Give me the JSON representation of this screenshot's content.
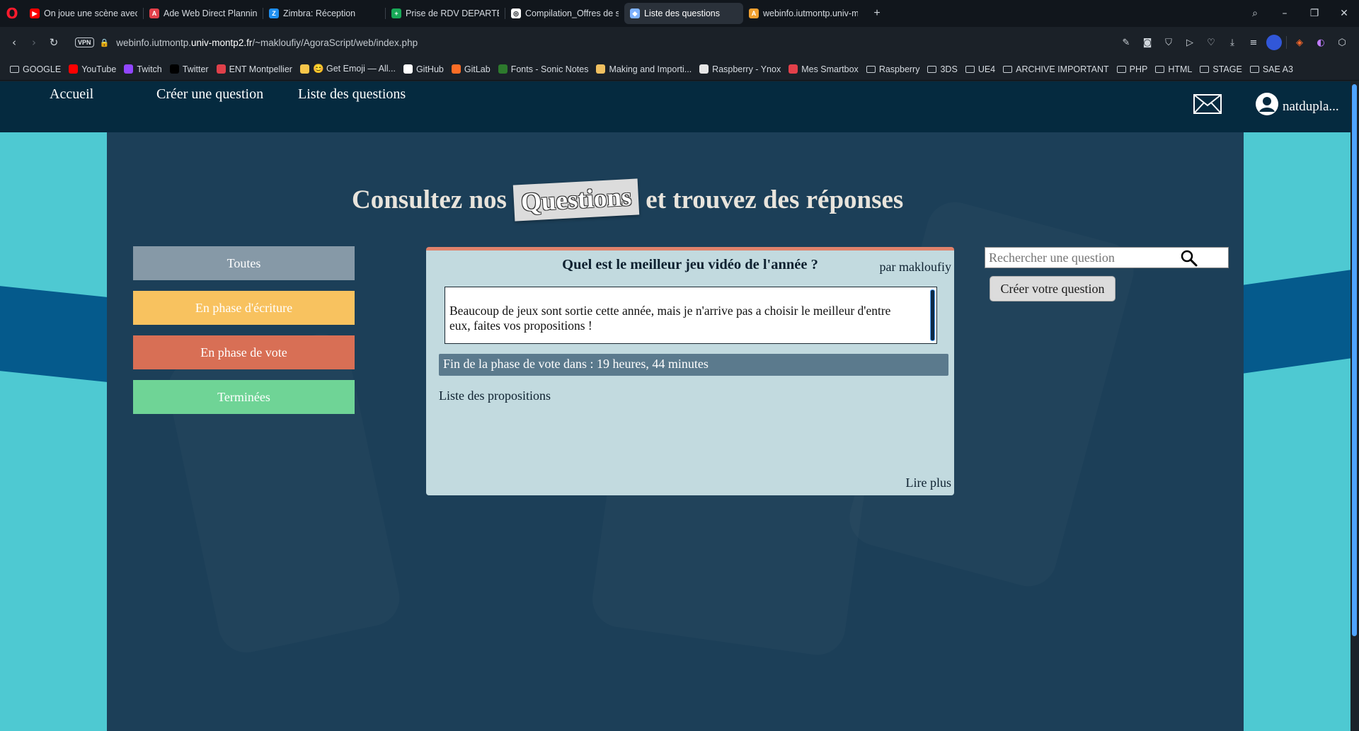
{
  "browser": {
    "tabs": [
      {
        "title": "On joue une scène avec M",
        "favicon": "youtube-icon",
        "color": "#ff0000"
      },
      {
        "title": "Ade Web Direct Planning",
        "favicon": "ade-icon",
        "color": "#e3404a"
      },
      {
        "title": "Zimbra: Réception",
        "favicon": "zimbra-icon",
        "color": "#1f8ff0"
      },
      {
        "title": "Prise de RDV DEPARTEMEN",
        "favicon": "sheets-icon",
        "color": "#18a857"
      },
      {
        "title": "Compilation_Offres de sta",
        "favicon": "globe-icon",
        "color": "#ffffff"
      },
      {
        "title": "Liste des questions",
        "favicon": "cube-icon",
        "color": "#7fb2ff",
        "active": true
      },
      {
        "title": "webinfo.iutmontp.univ-m",
        "favicon": "agora-icon",
        "color": "#f0a030"
      }
    ],
    "url_prefix": "webinfo.iutmontp.",
    "url_domain": "univ-montp2.fr",
    "url_path": "/~makloufiy/AgoraScript/web/index.php",
    "vpn_label": "VPN",
    "bookmarks": [
      {
        "label": "GOOGLE",
        "icon": "folder-icon"
      },
      {
        "label": "YouTube",
        "icon": "youtube-icon",
        "color": "#ff0000"
      },
      {
        "label": "Twitch",
        "icon": "twitch-icon",
        "color": "#9146ff"
      },
      {
        "label": "Twitter",
        "icon": "x-icon",
        "color": "#000000"
      },
      {
        "label": "ENT Montpellier",
        "icon": "ent-icon",
        "color": "#e0404a"
      },
      {
        "label": "😊 Get Emoji — All...",
        "icon": "emoji-icon",
        "color": "#f7c64a"
      },
      {
        "label": "GitHub",
        "icon": "github-icon",
        "color": "#ffffff"
      },
      {
        "label": "GitLab",
        "icon": "gitlab-icon",
        "color": "#fc6d26"
      },
      {
        "label": "Fonts - Sonic Notes",
        "icon": "sonic-icon",
        "color": "#2d7a2d"
      },
      {
        "label": "Making and Importi...",
        "icon": "making-icon",
        "color": "#f0c060"
      },
      {
        "label": "Raspberry - Ynox",
        "icon": "page-icon",
        "color": "#e6e6e6"
      },
      {
        "label": "Mes Smartbox",
        "icon": "smartbox-icon",
        "color": "#e3404a"
      },
      {
        "label": "Raspberry",
        "icon": "folder-icon"
      },
      {
        "label": "3DS",
        "icon": "folder-icon"
      },
      {
        "label": "UE4",
        "icon": "folder-icon"
      },
      {
        "label": "ARCHIVE IMPORTANT",
        "icon": "folder-icon"
      },
      {
        "label": "PHP",
        "icon": "folder-icon"
      },
      {
        "label": "HTML",
        "icon": "folder-icon"
      },
      {
        "label": "STAGE",
        "icon": "folder-icon"
      },
      {
        "label": "SAE A3",
        "icon": "folder-icon"
      }
    ]
  },
  "site": {
    "nav": {
      "home": "Accueil",
      "create": "Créer une question",
      "list": "Liste des questions",
      "username": "natdupla..."
    },
    "hero": {
      "before": "Consultez nos",
      "highlight": "Questions",
      "after": "et trouvez des réponses"
    },
    "filters": [
      {
        "label": "Toutes",
        "color": "#8699a7"
      },
      {
        "label": "En phase d'écriture",
        "color": "#f8c25f"
      },
      {
        "label": "En phase de vote",
        "color": "#d86f55"
      },
      {
        "label": "Terminées",
        "color": "#6fd496"
      }
    ],
    "question": {
      "title": "Quel est le meilleur jeu vidéo de l'année ?",
      "author": "par makloufiy",
      "body": "Beaucoup de jeux sont sortie cette année, mais je n'arrive pas a choisir le meilleur d'entre eux, faites vos propositions !",
      "deadline": "Fin de la phase de vote dans : 19 heures, 44 minutes",
      "proposals_label": "Liste des propositions",
      "read_more": "Lire plus"
    },
    "search": {
      "placeholder": "Rechercher une question"
    },
    "create_button": "Créer votre question",
    "colors": {
      "nav_bg": "#052a3f",
      "panel_bg": "#1c3f58",
      "side_cyan": "#4ec9d2",
      "side_blue": "#055a8c",
      "card_bg": "#c2dadf",
      "card_accent": "#e0826b"
    }
  }
}
